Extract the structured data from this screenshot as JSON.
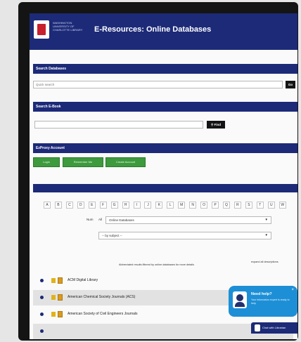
{
  "header": {
    "logo_text": "WASHINGTON UNIVERSITY OF CHARLOTTE LIBRARY",
    "title": "E-Resources: Online Databases"
  },
  "search_databases": {
    "heading": "Search Databases",
    "placeholder": "Quick search",
    "button": "Go"
  },
  "search_ebook": {
    "heading": "Search E-Book",
    "placeholder": "",
    "button": "Find"
  },
  "ezproxy": {
    "heading": "EzProxy Account",
    "buttons": [
      "Login",
      "Remember Me",
      "Create Account"
    ]
  },
  "alphabet": [
    "A",
    "B",
    "C",
    "D",
    "E",
    "F",
    "G",
    "H",
    "I",
    "J",
    "K",
    "L",
    "M",
    "N",
    "O",
    "P",
    "Q",
    "R",
    "S",
    "T",
    "U",
    "W"
  ],
  "filter": {
    "prefix1": "Num",
    "prefix2": "All",
    "type_value": "Online Databases",
    "subject_value": "-- by subject --"
  },
  "notes": {
    "center": "Abbreviated results filtered by online databases for more details",
    "right": "expand all descriptions"
  },
  "databases": [
    {
      "name": "ACM Digital Library"
    },
    {
      "name": "American Chemical Society Journals (ACS)"
    },
    {
      "name": "American Society of Civil Engineers Journals"
    },
    {
      "name": ""
    }
  ],
  "chat": {
    "title": "Need help?",
    "body": "Your information expert is ready to help",
    "bar_label": "Chat with Librarian",
    "close": "×"
  },
  "colors": {
    "navy": "#1c2a78",
    "green": "#3d9a3d",
    "chat_blue": "#1d8fd6"
  }
}
